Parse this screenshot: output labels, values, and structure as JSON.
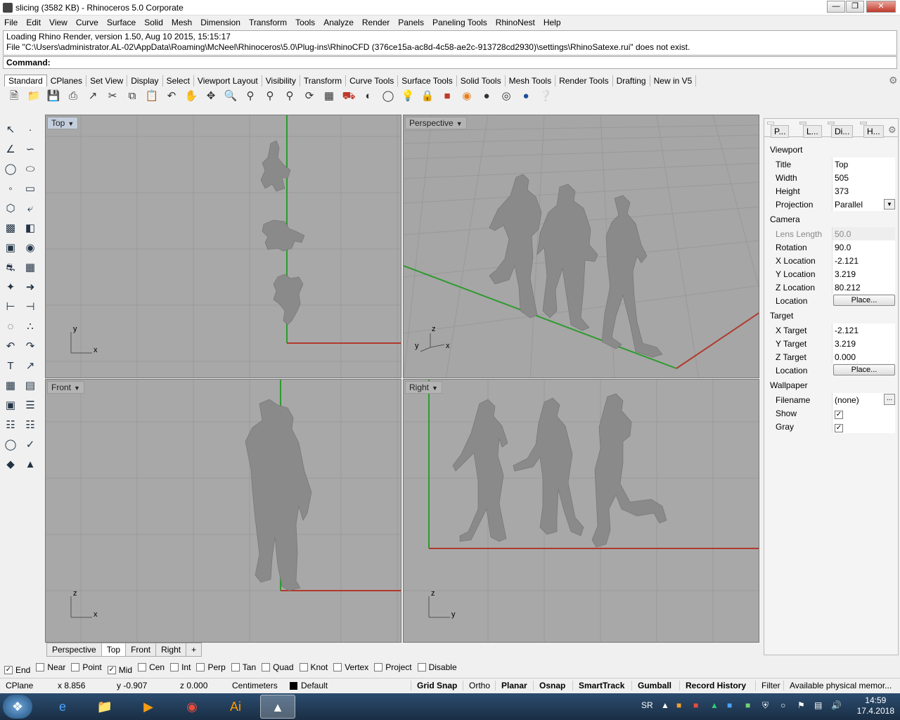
{
  "window": {
    "title": "slicing (3582 KB) - Rhinoceros  5.0 Corporate"
  },
  "menu": [
    "File",
    "Edit",
    "View",
    "Curve",
    "Surface",
    "Solid",
    "Mesh",
    "Dimension",
    "Transform",
    "Tools",
    "Analyze",
    "Render",
    "Panels",
    "Paneling Tools",
    "RhinoNest",
    "Help"
  ],
  "command_history": [
    "Loading Rhino Render, version 1.50, Aug 10 2015, 15:15:17",
    "File \"C:\\Users\\administrator.AL-02\\AppData\\Roaming\\McNeel\\Rhinoceros\\5.0\\Plug-ins\\RhinoCFD (376ce15a-ac8d-4c58-ae2c-913728cd2930)\\settings\\RhinoSatexe.rui\" does not exist."
  ],
  "command_prompt": "Command:",
  "toolbar_tabs": [
    "Standard",
    "CPlanes",
    "Set View",
    "Display",
    "Select",
    "Viewport Layout",
    "Visibility",
    "Transform",
    "Curve Tools",
    "Surface Tools",
    "Solid Tools",
    "Mesh Tools",
    "Render Tools",
    "Drafting",
    "New in V5"
  ],
  "toolbar_icons": [
    "new-icon",
    "open-icon",
    "save-icon",
    "print-icon",
    "import-icon",
    "cut-icon",
    "copy-icon",
    "paste-icon",
    "undo-icon",
    "pan-icon",
    "move-icon",
    "zoom-icon",
    "zoom-window-icon",
    "zoom-extents-icon",
    "zoom-selected-icon",
    "rotate-view-icon",
    "four-view-icon",
    "car-icon",
    "hide-icon",
    "lock-icon",
    "light-icon",
    "lock-object-icon",
    "layer-icon",
    "color-wheel-icon",
    "render-preview-icon",
    "material-icon",
    "sphere-render-icon",
    "help-icon"
  ],
  "viewports": {
    "top": {
      "label": "Top",
      "axis1": "y",
      "axis2": "x"
    },
    "perspective": {
      "label": "Perspective",
      "axis1": "z",
      "axis2": "y",
      "axis3": "x"
    },
    "front": {
      "label": "Front",
      "axis1": "z",
      "axis2": "x"
    },
    "right": {
      "label": "Right",
      "axis1": "z",
      "axis2": "y"
    }
  },
  "viewport_tabs": [
    "Perspective",
    "Top",
    "Front",
    "Right"
  ],
  "viewport_tab_add": "+",
  "osnaps": [
    {
      "label": "End",
      "checked": true
    },
    {
      "label": "Near",
      "checked": false
    },
    {
      "label": "Point",
      "checked": false
    },
    {
      "label": "Mid",
      "checked": true
    },
    {
      "label": "Cen",
      "checked": false
    },
    {
      "label": "Int",
      "checked": false
    },
    {
      "label": "Perp",
      "checked": false
    },
    {
      "label": "Tan",
      "checked": false
    },
    {
      "label": "Quad",
      "checked": false
    },
    {
      "label": "Knot",
      "checked": false
    },
    {
      "label": "Vertex",
      "checked": false
    },
    {
      "label": "Project",
      "checked": false
    },
    {
      "label": "Disable",
      "checked": false
    }
  ],
  "status": {
    "cplane": "CPlane",
    "x": "x 8.856",
    "y": "y -0.907",
    "z": "z 0.000",
    "units": "Centimeters",
    "layer": "Default",
    "buttons": [
      "Grid Snap",
      "Ortho",
      "Planar",
      "Osnap",
      "SmartTrack",
      "Gumball",
      "Record History",
      "Filter"
    ],
    "memory": "Available physical memor..."
  },
  "panel": {
    "tabs": [
      "P...",
      "L...",
      "Di...",
      "H..."
    ],
    "viewport_header": "Viewport",
    "title_label": "Title",
    "title_value": "Top",
    "width_label": "Width",
    "width_value": "505",
    "height_label": "Height",
    "height_value": "373",
    "projection_label": "Projection",
    "projection_value": "Parallel",
    "camera_header": "Camera",
    "lens_label": "Lens Length",
    "lens_value": "50.0",
    "rotation_label": "Rotation",
    "rotation_value": "90.0",
    "xloc_label": "X Location",
    "xloc_value": "-2.121",
    "yloc_label": "Y Location",
    "yloc_value": "3.219",
    "zloc_label": "Z Location",
    "zloc_value": "80.212",
    "location_label": "Location",
    "place_label": "Place...",
    "target_header": "Target",
    "xt_label": "X Target",
    "xt_value": "-2.121",
    "yt_label": "Y Target",
    "yt_value": "3.219",
    "zt_label": "Z Target",
    "zt_value": "0.000",
    "tloc_label": "Location",
    "tplace_label": "Place...",
    "wallpaper_header": "Wallpaper",
    "filename_label": "Filename",
    "filename_value": "(none)",
    "browse_label": "...",
    "show_label": "Show",
    "show_checked": true,
    "gray_label": "Gray",
    "gray_checked": true
  },
  "taskbar": {
    "lang": "SR",
    "time": "14:59",
    "date": "17.4.2018"
  }
}
